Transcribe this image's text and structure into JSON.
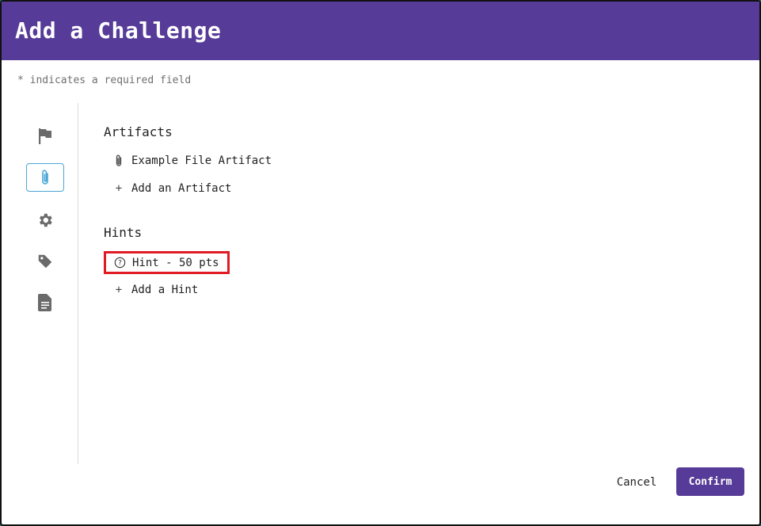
{
  "modal": {
    "title": "Add a Challenge",
    "required_note": "* indicates a required field"
  },
  "sidebar": {
    "items": [
      {
        "icon": "flag-icon",
        "active": false
      },
      {
        "icon": "paperclip-icon",
        "active": true
      },
      {
        "icon": "gear-icon",
        "active": false
      },
      {
        "icon": "tag-icon",
        "active": false
      },
      {
        "icon": "document-icon",
        "active": false
      }
    ]
  },
  "artifacts": {
    "title": "Artifacts",
    "items": [
      {
        "label": "Example File Artifact",
        "icon": "paperclip-icon"
      }
    ],
    "add_label": "Add an Artifact"
  },
  "hints": {
    "title": "Hints",
    "items": [
      {
        "label": "Hint - 50 pts",
        "icon": "question-circle-icon"
      }
    ],
    "add_label": "Add a Hint"
  },
  "footer": {
    "cancel_label": "Cancel",
    "confirm_label": "Confirm"
  },
  "colors": {
    "header": "#573b98",
    "confirm_button": "#573b98",
    "active_sidebar_border": "#4aa6d6",
    "highlight_box": "#e01b24"
  }
}
